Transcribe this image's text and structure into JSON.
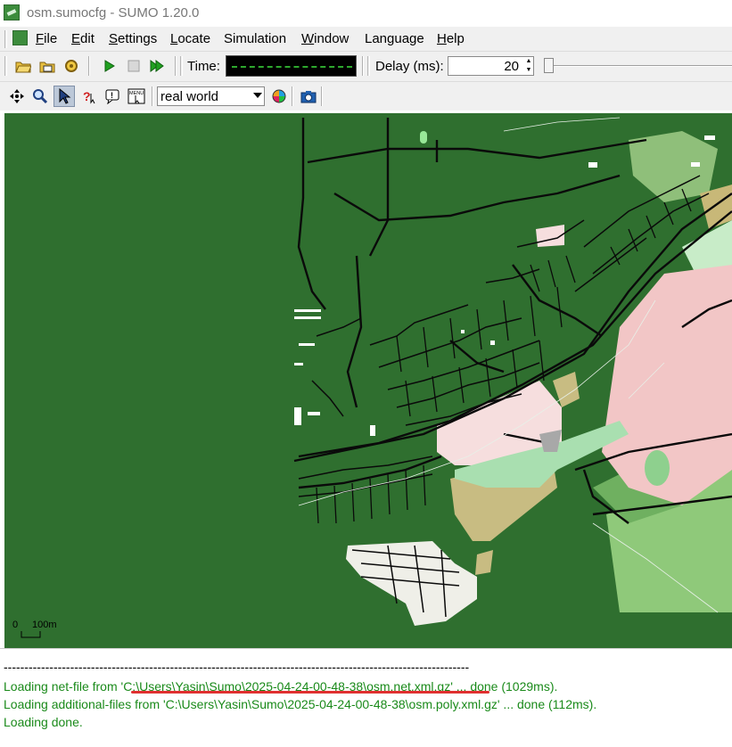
{
  "window": {
    "title": "osm.sumocfg - SUMO 1.20.0"
  },
  "menubar": {
    "items": [
      {
        "label": "File",
        "mnemonic": "F",
        "rest": "ile"
      },
      {
        "label": "Edit",
        "mnemonic": "E",
        "rest": "dit"
      },
      {
        "label": "Settings",
        "mnemonic": "S",
        "rest": "ettings"
      },
      {
        "label": "Locate",
        "mnemonic": "L",
        "rest": "ocate"
      },
      {
        "label": "Simulation",
        "mnemonic": "",
        "rest": "Simulation"
      },
      {
        "label": "Window",
        "mnemonic": "W",
        "rest": "indow"
      },
      {
        "label": "Language",
        "mnemonic": "",
        "rest": "Language"
      },
      {
        "label": "Help",
        "mnemonic": "H",
        "rest": "elp"
      }
    ]
  },
  "toolbar": {
    "buttons": [
      {
        "icon": "open-folder-icon"
      },
      {
        "icon": "open-network-icon"
      },
      {
        "icon": "reload-icon"
      },
      {
        "icon": "run-icon"
      },
      {
        "icon": "stop-icon"
      },
      {
        "icon": "step-icon"
      }
    ],
    "time_label": "Time:",
    "delay_label": "Delay (ms):",
    "delay_value": "20",
    "delay_slider_fraction": 0.0
  },
  "view_toolbar": {
    "buttons": [
      {
        "icon": "recenter-icon"
      },
      {
        "icon": "zoom-icon"
      },
      {
        "icon": "pointer-icon",
        "pressed": true
      },
      {
        "icon": "help-locate-icon"
      },
      {
        "icon": "tooltip-icon"
      },
      {
        "icon": "menu-icon",
        "text": "MENU"
      }
    ],
    "scheme_selected": "real world",
    "colors": {
      "map_bg": "#2f6f2f",
      "log_green": "#1a8a1a",
      "underline": "#e03030"
    }
  },
  "map": {
    "scale_zero": "0",
    "scale_label": "100m"
  },
  "log": {
    "separator": "----------------------------------------------------------------------------------------------------------------",
    "lines": [
      "Loading net-file from 'C:\\Users\\Yasin\\Sumo\\2025-04-24-00-48-38\\osm.net.xml.gz' ... done (1029ms).",
      "Loading additional-files from 'C:\\Users\\Yasin\\Sumo\\2025-04-24-00-48-38\\osm.poly.xml.gz' ... done (112ms).",
      "Loading done."
    ]
  }
}
